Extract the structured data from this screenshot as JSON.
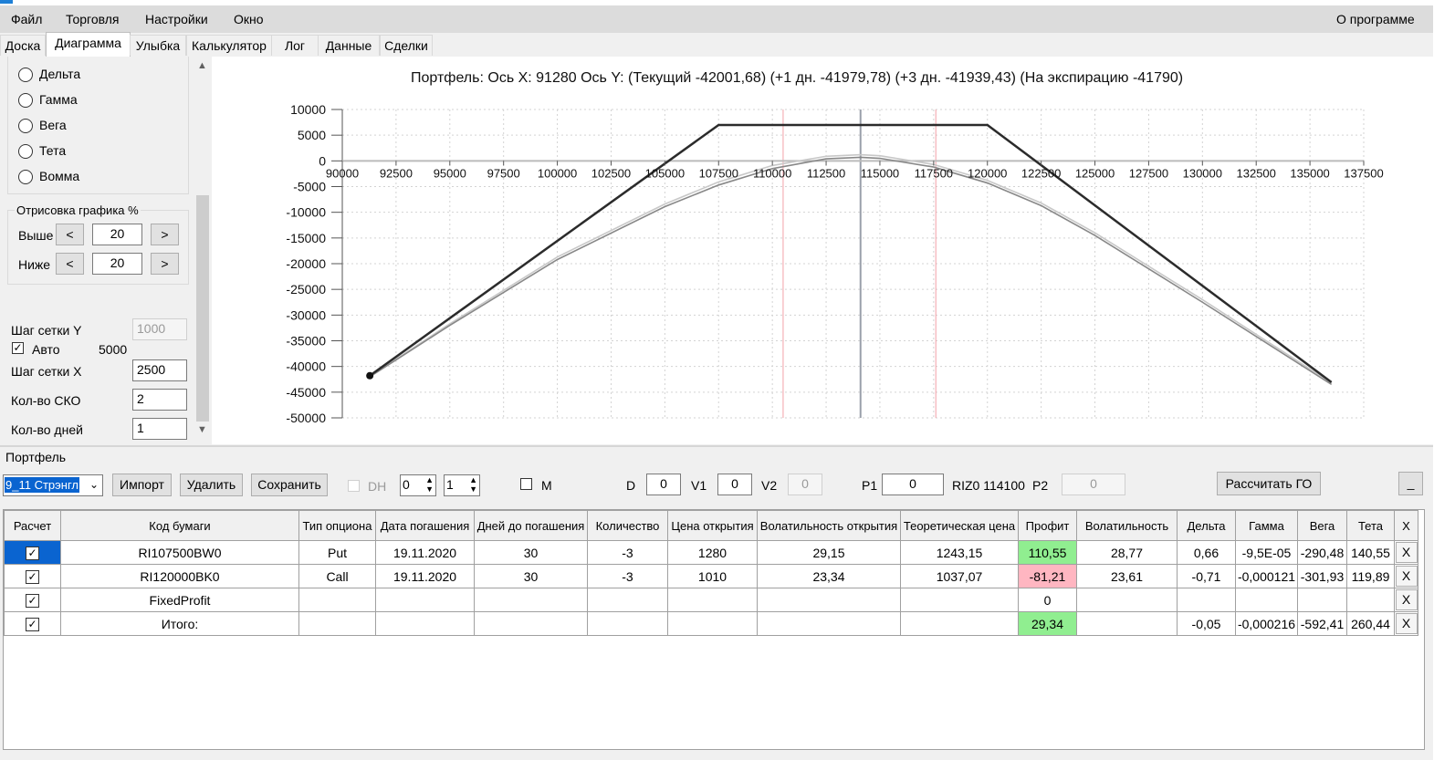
{
  "menu": {
    "items": [
      "Файл",
      "Торговля",
      "Настройки",
      "Окно"
    ],
    "about": "О программе"
  },
  "tabs": [
    "Доска",
    "Диаграмма",
    "Улыбка",
    "Калькулятор",
    "Лог",
    "Данные",
    "Сделки"
  ],
  "active_tab": "Диаграмма",
  "left": {
    "radios": [
      "Дельта",
      "Гамма",
      "Вега",
      "Тета",
      "Вомма"
    ],
    "draw_group_title": "Отрисовка графика %",
    "above_label": "Выше",
    "above_value": "20",
    "below_label": "Ниже",
    "below_value": "20",
    "prev": "<",
    "next": ">",
    "grid_y_label": "Шаг сетки Y",
    "grid_y_value": "1000",
    "auto_label": "Авто",
    "auto_value": "5000",
    "grid_x_label": "Шаг сетки X",
    "grid_x_value": "2500",
    "sko_label": "Кол-во СКО",
    "sko_value": "2",
    "days_label": "Кол-во дней",
    "days_value": "1"
  },
  "chart_data": {
    "type": "line",
    "title": "Портфель: Ось X: 91280 Ось Y:  (Текущий -42001,68)  (+1 дн. -41979,78)  (+3 дн. -41939,43)  (На экспирацию -41790)",
    "xlim": [
      90000,
      137500
    ],
    "ylim": [
      -50000,
      10000
    ],
    "x_ticks": [
      90000,
      92500,
      95000,
      97500,
      100000,
      102500,
      105000,
      107500,
      110000,
      112500,
      115000,
      117500,
      120000,
      122500,
      125000,
      127500,
      130000,
      132500,
      135000,
      137500
    ],
    "y_ticks": [
      10000,
      5000,
      0,
      -5000,
      -10000,
      -15000,
      -20000,
      -25000,
      -30000,
      -35000,
      -40000,
      -45000,
      -50000
    ],
    "series": [
      {
        "color": "#2b2b2b",
        "x": [
          91280,
          107500,
          120000,
          136000
        ],
        "y": [
          -41790,
          6990,
          6990,
          -43080
        ]
      },
      {
        "color": "#888888",
        "x": [
          91280,
          95000,
          100000,
          105000,
          107500,
          110000,
          112500,
          114100,
          115000,
          117500,
          120000,
          122500,
          125000,
          130000,
          136000
        ],
        "y": [
          -42002,
          -32000,
          -19200,
          -8900,
          -4700,
          -1500,
          400,
          690,
          500,
          -1200,
          -4300,
          -8700,
          -14500,
          -27500,
          -43500
        ]
      },
      {
        "color": "#c8c8c8",
        "x": [
          91280,
          95000,
          100000,
          105000,
          107500,
          110000,
          112500,
          114100,
          115000,
          117500,
          120000,
          122500,
          125000,
          130000,
          136000
        ],
        "y": [
          -41940,
          -31700,
          -18700,
          -8400,
          -4100,
          -900,
          900,
          1200,
          1000,
          -700,
          -3800,
          -8200,
          -14000,
          -27000,
          -43200
        ]
      }
    ],
    "marker": {
      "x": 91280,
      "y": -41790
    },
    "vlines": [
      {
        "x": 114100,
        "color": "#9aa0aa"
      },
      {
        "x": 110500,
        "color": "#f3a0a8"
      },
      {
        "x": 117600,
        "color": "#f3a0a8"
      }
    ],
    "grid": true
  },
  "portfolio": {
    "label": "Портфель",
    "combo": "9_11 Стрэнгл",
    "import": "Импорт",
    "delete": "Удалить",
    "save": "Сохранить",
    "dh": "DH",
    "spin1": "0",
    "spin2": "1",
    "m": "M",
    "d_label": "D",
    "d_value": "0",
    "v1_label": "V1",
    "v1_value": "0",
    "v2_label": "V2",
    "v2_value": "0",
    "p1_label": "P1",
    "p1_value": "0",
    "riz": "RIZ0 114100",
    "p2_label": "P2",
    "p2_value": "0",
    "calc_go": "Рассчитать ГО",
    "minimize": "_"
  },
  "table": {
    "headers": [
      "Расчет",
      "Код бумаги",
      "Тип опциона",
      "Дата погашения",
      "Дней до погашения",
      "Количество",
      "Цена открытия",
      "Волатильность открытия",
      "Теоретическая цена",
      "Профит",
      "Волатильность",
      "Дельта",
      "Гамма",
      "Вега",
      "Тета",
      "X"
    ],
    "rows": [
      [
        "✓",
        "RI107500BW0",
        "Put",
        "19.11.2020",
        "30",
        "-3",
        "1280",
        "29,15",
        "1243,15",
        "110,55",
        "28,77",
        "0,66",
        "-9,5E-05",
        "-290,48",
        "140,55",
        "X"
      ],
      [
        "✓",
        "RI120000BK0",
        "Call",
        "19.11.2020",
        "30",
        "-3",
        "1010",
        "23,34",
        "1037,07",
        "-81,21",
        "23,61",
        "-0,71",
        "-0,000121",
        "-301,93",
        "119,89",
        "X"
      ],
      [
        "✓",
        "FixedProfit",
        "",
        "",
        "",
        "",
        "",
        "",
        "",
        "0",
        "",
        "",
        "",
        "",
        "",
        "X"
      ],
      [
        "✓",
        "Итого:",
        "",
        "",
        "",
        "",
        "",
        "",
        "",
        "29,34",
        "",
        "-0,05",
        "-0,000216",
        "-592,41",
        "260,44",
        "X"
      ]
    ],
    "profit_colors": [
      "#90ee90",
      "#ffb6c1",
      "#ffffff",
      "#90ee90"
    ]
  }
}
